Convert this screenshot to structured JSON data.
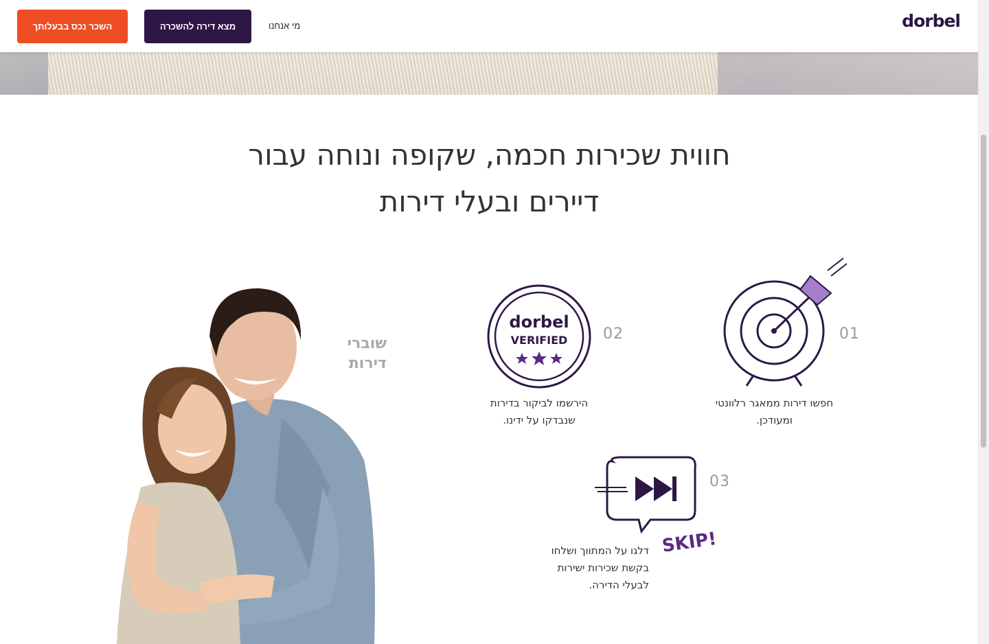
{
  "header": {
    "logo": "dorbel",
    "nav_about": "מי אנחנו",
    "find_button": "מצא דירה להשכרה",
    "rent_button": "השכר נכס בבעלותך"
  },
  "main": {
    "headline_line1": "חווית שכירות חכמה, שקופה ונוחה עבור",
    "headline_line2": "דיירים ובעלי דירות",
    "renters_label_line1": "שוברי",
    "renters_label_line2": "דירות",
    "features": [
      {
        "number": "01",
        "icon": "target-icon",
        "line1": "חפשו דירות ממאגר רלוונטי",
        "line2": "ומעודכן."
      },
      {
        "number": "02",
        "icon": "dorbel-verified-badge-icon",
        "badge_brand": "dorbel",
        "badge_text": "VERIFIED",
        "line1": "הירשמו לביקור בדירות",
        "line2": "שנבדקו על ידינו."
      },
      {
        "number": "03",
        "icon": "skip-forward-chat-icon",
        "skip_text": "SKIP!",
        "line1": "דלגו על המתווך ושלחו",
        "line2": "בקשת שכירות ישירות",
        "line3": "לבעלי הדירה."
      }
    ]
  },
  "colors": {
    "brand_purple": "#2e1746",
    "accent_orange": "#ee4c23",
    "icon_purple": "#5b2a86",
    "light_purple": "#a57fc9"
  }
}
